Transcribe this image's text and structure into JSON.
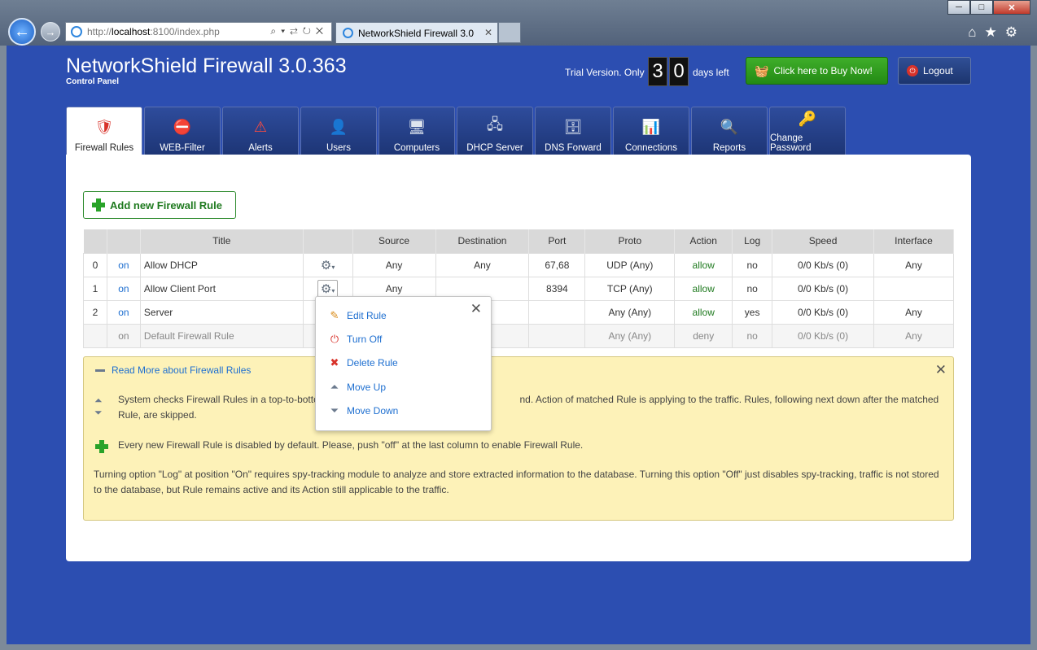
{
  "browser": {
    "url_prefix": "http://",
    "url_host": "localhost",
    "url_rest": ":8100/index.php",
    "tab_title": "NetworkShield Firewall 3.0",
    "win_min": "─",
    "win_max": "□",
    "win_close": "✕",
    "back": "←",
    "fwd": "→",
    "addr_icons": "⌕▾⇄↻✕",
    "tab_close": "✕",
    "tools": "⌂★⚙"
  },
  "header": {
    "title": "NetworkShield Firewall 3.0.363",
    "subtitle": "Control Panel",
    "trial_text": "Trial Version. Only",
    "digit1": "3",
    "digit2": "0",
    "days_left": "days left",
    "buy_label": "Click here to Buy Now!",
    "buy_icon": "🧺",
    "logout_label": "Logout",
    "logout_icon": "⏻"
  },
  "tabs": [
    {
      "label": "Firewall Rules",
      "icon": "shield-icon"
    },
    {
      "label": "WEB-Filter",
      "icon": "monitor-block-icon"
    },
    {
      "label": "Alerts",
      "icon": "warning-icon"
    },
    {
      "label": "Users",
      "icon": "user-icon"
    },
    {
      "label": "Computers",
      "icon": "computer-icon"
    },
    {
      "label": "DHCP Server",
      "icon": "network-icon"
    },
    {
      "label": "DNS Forward",
      "icon": "server-icon"
    },
    {
      "label": "Connections",
      "icon": "chart-icon"
    },
    {
      "label": "Reports",
      "icon": "report-icon"
    },
    {
      "label": "Change Password",
      "icon": "key-icon"
    }
  ],
  "tab_glyphs": [
    "🛡",
    "⛔",
    "⚠",
    "👤",
    "🖥",
    "🖧",
    "🗄",
    "📊",
    "🔍",
    "🔑"
  ],
  "add_rule_label": "Add new Firewall Rule",
  "table": {
    "headers": [
      "",
      "",
      "Title",
      "",
      "Source",
      "Destination",
      "Port",
      "Proto",
      "Action",
      "Log",
      "Speed",
      "Interface"
    ],
    "rows": [
      {
        "num": "0",
        "state": "on",
        "title": "Allow DHCP",
        "source": "Any",
        "destination": "Any",
        "port": "67,68",
        "proto": "UDP (Any)",
        "action": "allow",
        "log": "no",
        "speed": "0/0 Kb/s (0)",
        "interface": "Any"
      },
      {
        "num": "1",
        "state": "on",
        "title": "Allow Client Port",
        "source": "Any",
        "destination": "",
        "port": "8394",
        "proto": "TCP (Any)",
        "action": "allow",
        "log": "no",
        "speed": "0/0 Kb/s (0)",
        "interface": ""
      },
      {
        "num": "2",
        "state": "on",
        "title": "Server",
        "source": "",
        "destination": "",
        "port": "",
        "proto": "Any (Any)",
        "action": "allow",
        "log": "yes",
        "speed": "0/0 Kb/s (0)",
        "interface": "Any"
      },
      {
        "num": "",
        "state": "on",
        "title": "Default Firewall Rule",
        "source": "",
        "destination": "",
        "port": "",
        "proto": "Any (Any)",
        "action": "deny",
        "log": "no",
        "speed": "0/0 Kb/s (0)",
        "interface": "Any"
      }
    ],
    "gear_glyph": "⚙",
    "caret_glyph": "▾"
  },
  "info": {
    "readmore": "Read More about Firewall Rules",
    "close": "✕",
    "updown_glyph_up": "⏶",
    "updown_glyph_down": "⏷",
    "p1": "System checks Firewall Rules in a top-to-botto                                                                          nd. Action of matched Rule is applying to the traffic. Rules, following next down after the matched Rule, are skipped.",
    "p2": "Every new Firewall Rule is disabled by default. Please, push \"off\" at the last column to enable Firewall Rule.",
    "p3": "Turning option \"Log\" at position \"On\" requires spy-tracking module to analyze and store extracted information to the database. Turning this option \"Off\" just disables spy-tracking, traffic is not stored to the database, but Rule remains active and its Action still applicable to the traffic."
  },
  "menu": {
    "close": "✕",
    "items": [
      {
        "label": "Edit Rule",
        "icon": "pencil-icon",
        "glyph": "✎",
        "color": "#d98c1a"
      },
      {
        "label": "Turn Off",
        "icon": "power-icon",
        "glyph": "⏻",
        "color": "#d8322a"
      },
      {
        "label": "Delete Rule",
        "icon": "delete-icon",
        "glyph": "✖",
        "color": "#d8322a"
      },
      {
        "label": "Move Up",
        "icon": "arrow-up-icon",
        "glyph": "⏶",
        "color": "#6b7a8e"
      },
      {
        "label": "Move Down",
        "icon": "arrow-down-icon",
        "glyph": "⏷",
        "color": "#6b7a8e"
      }
    ]
  }
}
